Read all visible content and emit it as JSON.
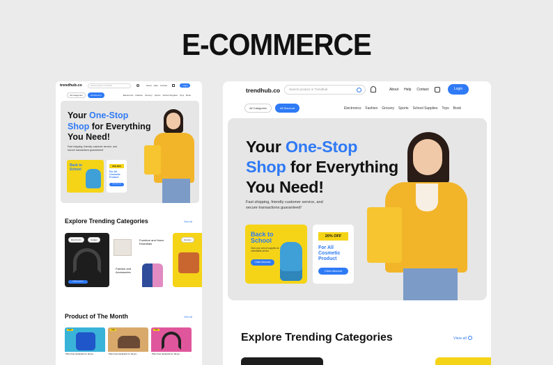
{
  "page_title": "E-COMMERCE",
  "brand": "trendhub.co",
  "search_placeholder": "Search product in Trendhub",
  "nav": {
    "about": "About",
    "help": "Help",
    "contact": "Contact",
    "login": "Login"
  },
  "category_pills": {
    "all_categories": "All Categories",
    "all_discount": "All Discount"
  },
  "category_links": [
    "Electronics",
    "Fashion",
    "Grocery",
    "Sports",
    "School Supplies",
    "Toys",
    "Book"
  ],
  "hero": {
    "line1_a": "Your ",
    "line1_b": "One-Stop",
    "line2_a": "Shop",
    "line2_b": " for Everything",
    "line3": "You Need!",
    "subtitle": "Fast shipping, friendly customer service, and secure transactions guaranteed!"
  },
  "promo1": {
    "title": "Back to School",
    "text": "Grab your school supplies at unbeatable prices!",
    "button": "Claim discount"
  },
  "promo2": {
    "badge": "20% OFF",
    "title": "For All Cosmetic Product",
    "button": "Claim discount"
  },
  "trending": {
    "title": "Explore Trending Categories",
    "view_all": "View all"
  },
  "small_categories": {
    "electronics": "Electronics",
    "gadget": "Gadget",
    "furniture": "Furniture and Home Essentials",
    "fashion": "Fashion and Accessories",
    "grocery": "Grocery",
    "explore": "Explore products"
  },
  "product_month": {
    "title": "Product of The Month",
    "view_all": "View all",
    "item_name": "Plain blue backpack for all gro...",
    "price_tag": "$0.45",
    "item_badge": "Sale"
  },
  "colors": {
    "accent": "#2f7af5",
    "yellow": "#f5d418",
    "hero_bg": "#e6e6e6"
  }
}
